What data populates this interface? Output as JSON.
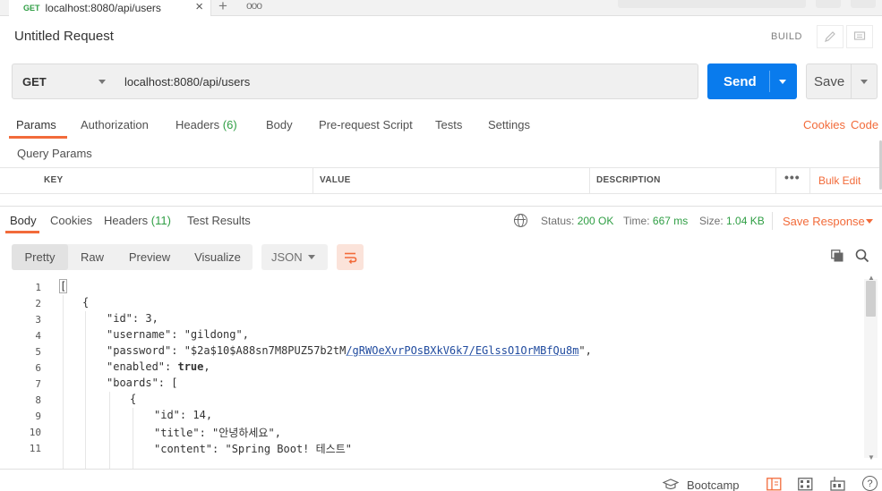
{
  "tab": {
    "method": "GET",
    "title": "localhost:8080/api/users",
    "close": "×",
    "add": "+",
    "more": "ooo"
  },
  "request": {
    "name": "Untitled Request",
    "build_label": "BUILD",
    "method": "GET",
    "url": "localhost:8080/api/users",
    "send_label": "Send",
    "save_label": "Save"
  },
  "request_tabs": [
    {
      "label": "Params",
      "active": true
    },
    {
      "label": "Authorization"
    },
    {
      "label": "Headers",
      "count": "(6)"
    },
    {
      "label": "Body"
    },
    {
      "label": "Pre-request Script"
    },
    {
      "label": "Tests"
    },
    {
      "label": "Settings"
    }
  ],
  "links": {
    "cookies": "Cookies",
    "code": "Code"
  },
  "query_params": {
    "title": "Query Params",
    "columns": [
      "KEY",
      "VALUE",
      "DESCRIPTION"
    ],
    "more": "•••",
    "bulk_edit": "Bulk Edit"
  },
  "response_tabs": [
    {
      "label": "Body",
      "active": true
    },
    {
      "label": "Cookies"
    },
    {
      "label": "Headers",
      "count": "(11)"
    },
    {
      "label": "Test Results"
    }
  ],
  "response_meta": {
    "status_label": "Status:",
    "status_value": "200 OK",
    "time_label": "Time:",
    "time_value": "667 ms",
    "size_label": "Size:",
    "size_value": "1.04 KB",
    "save_response": "Save Response"
  },
  "format_tabs": [
    {
      "label": "Pretty",
      "active": true
    },
    {
      "label": "Raw"
    },
    {
      "label": "Preview"
    },
    {
      "label": "Visualize"
    }
  ],
  "language": "JSON",
  "code_lines": [
    {
      "n": "1",
      "text": "["
    },
    {
      "n": "2",
      "text": "{"
    },
    {
      "n": "3",
      "key": "\"id\"",
      "sep": ": ",
      "val": "3",
      "trail": ","
    },
    {
      "n": "4",
      "key": "\"username\"",
      "sep": ": ",
      "val": "\"gildong\"",
      "trail": ","
    },
    {
      "n": "5",
      "key": "\"password\"",
      "sep": ": ",
      "val_a": "\"$2a$10$A88sn7M8PUZ57b2tM",
      "val_b": "/gRWOeXvrPOsBXkV6k7/EGlssO1OrMBfQu8m",
      "val_c": "\"",
      "trail": ","
    },
    {
      "n": "6",
      "key": "\"enabled\"",
      "sep": ": ",
      "val": "true",
      "trail": ","
    },
    {
      "n": "7",
      "key": "\"boards\"",
      "sep": ": ",
      "val": "["
    },
    {
      "n": "8",
      "text": "{"
    },
    {
      "n": "9",
      "key": "\"id\"",
      "sep": ": ",
      "val": "14",
      "trail": ","
    },
    {
      "n": "10",
      "key": "\"title\"",
      "sep": ": ",
      "val": "\"안녕하세요\"",
      "trail": ","
    },
    {
      "n": "11",
      "key": "\"content\"",
      "sep": ": ",
      "val": "\"Spring Boot! 테스트\""
    }
  ],
  "footer": {
    "bootcamp": "Bootcamp",
    "help": "?"
  },
  "colors": {
    "accent": "#f26b3a",
    "send": "#097bed",
    "status_ok": "#2f9e44"
  }
}
